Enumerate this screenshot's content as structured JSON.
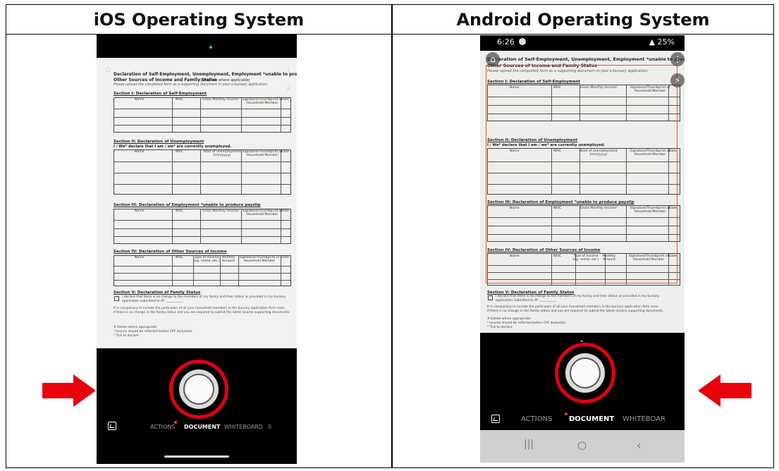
{
  "table_header": {
    "left_title": "iOS Operating System",
    "right_title": "Android Operating System"
  },
  "document": {
    "title_line1": "Declaration of Self-Employment, Unemployment, Employment *unable to produce payslip,",
    "title_line2": "Other Sources of Income and Family Status",
    "title_line2_suffix": "(complete where applicable)",
    "instruction": "Please upload the completed form as a supporting document in your e-bursary application.",
    "section1": "Section I: Declaration of Self-Employment",
    "section2": "Section II: Declaration of Unemployment",
    "section2_sub": "I / We* declare that I am / we* are currently unemployed.",
    "section3": "Section III: Declaration of Employment *unable to produce payslip",
    "section4": "Section IV: Declaration of Other Sources of Income",
    "section5": "Section V: Declaration of Family Status",
    "col_name": "Name",
    "col_nric": "NRIC",
    "col_gmi": "Gross Monthly Income¹",
    "col_sig": "Signature/Thumbprint of Household Member",
    "col_date": "Date",
    "col_start": "Start of unemployment (mm/yyyy)",
    "col_type": "Type of Income (eg. rental, etc.)",
    "col_monthly": "Monthly Amount",
    "family_line1": "I declare that there is no change to the members of my family and their status as provided in my bursary",
    "family_line2": "application submitted to AY ___________.",
    "compulsory_line1": "It is compulsory to include the particulars of all your household members in the bursary application form even",
    "compulsory_line2": "if there is no change in the family status and you are required to submit the latest income supporting documents.",
    "note1": "# Delete where appropriate",
    "note2": "¹ Income should be reflected before CPF deduction",
    "note3": "* Tick to declare"
  },
  "ios": {
    "modes": [
      "ACTIONS",
      "DOCUMENT",
      "WHITEBOARD",
      "B"
    ],
    "active_mode": "DOCUMENT"
  },
  "android": {
    "status_time": "6:26",
    "status_battery": "25%",
    "modes": [
      "ACTIONS",
      "DOCUMENT",
      "WHITEBOAR"
    ],
    "active_mode": "DOCUMENT"
  },
  "colors": {
    "highlight_red": "#e3000f",
    "detection_orange": "#e4572e",
    "arrow_red": "#e8000b"
  }
}
